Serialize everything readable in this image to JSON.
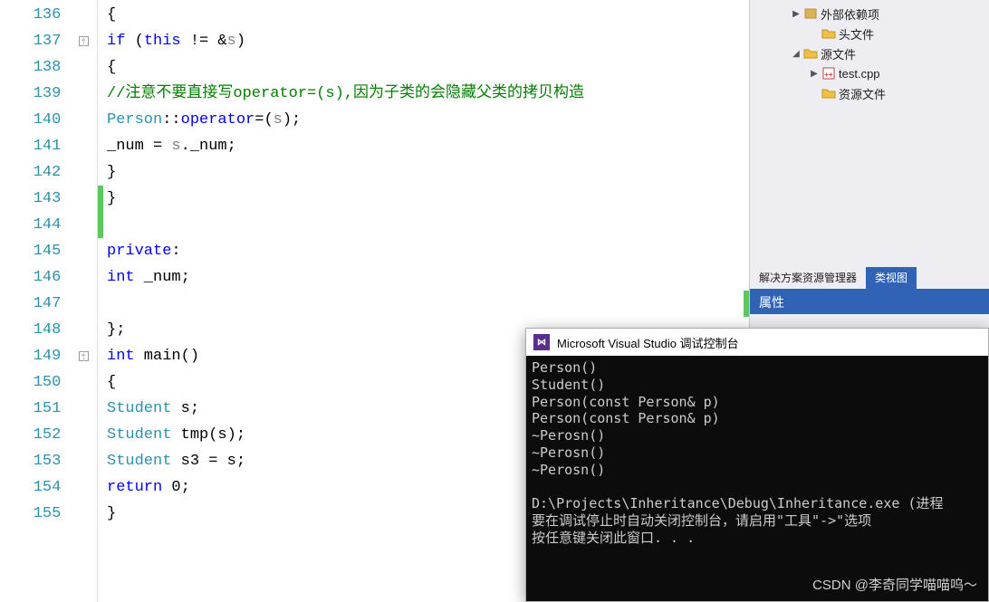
{
  "code": {
    "lines": [
      {
        "num": 136,
        "indent": 3,
        "tokens": [
          {
            "t": "{",
            "c": "punct"
          }
        ]
      },
      {
        "num": 137,
        "indent": 4,
        "fold": "-",
        "tokens": [
          {
            "t": "if",
            "c": "kw"
          },
          {
            "t": " (",
            "c": "punct"
          },
          {
            "t": "this",
            "c": "kw"
          },
          {
            "t": " != &",
            "c": "punct"
          },
          {
            "t": "s",
            "c": "gray"
          },
          {
            "t": ")",
            "c": "punct"
          }
        ]
      },
      {
        "num": 138,
        "indent": 4,
        "tokens": [
          {
            "t": "{",
            "c": "punct"
          }
        ]
      },
      {
        "num": 139,
        "indent": 5,
        "tokens": [
          {
            "t": "//注意不要直接写operator=(s),因为子类的会隐藏父类的拷贝构造",
            "c": "comment"
          }
        ]
      },
      {
        "num": 140,
        "indent": 5,
        "tokens": [
          {
            "t": "Person",
            "c": "type"
          },
          {
            "t": "::",
            "c": "punct"
          },
          {
            "t": "operator",
            "c": "kw"
          },
          {
            "t": "=(",
            "c": "punct"
          },
          {
            "t": "s",
            "c": "gray"
          },
          {
            "t": ");",
            "c": "punct"
          }
        ]
      },
      {
        "num": 141,
        "indent": 5,
        "tokens": [
          {
            "t": "_num = ",
            "c": "ident"
          },
          {
            "t": "s",
            "c": "gray"
          },
          {
            "t": "._num;",
            "c": "ident"
          }
        ]
      },
      {
        "num": 142,
        "indent": 4,
        "tokens": [
          {
            "t": "}",
            "c": "punct"
          }
        ]
      },
      {
        "num": 143,
        "indent": 3,
        "change": true,
        "tokens": [
          {
            "t": "}",
            "c": "punct"
          }
        ]
      },
      {
        "num": 144,
        "indent": 2,
        "change": true,
        "tokens": []
      },
      {
        "num": 145,
        "indent": 2,
        "tokens": [
          {
            "t": "private",
            "c": "kw"
          },
          {
            "t": ":",
            "c": "punct"
          }
        ]
      },
      {
        "num": 146,
        "indent": 3,
        "tokens": [
          {
            "t": "int",
            "c": "kw"
          },
          {
            "t": " _num;",
            "c": "ident"
          }
        ]
      },
      {
        "num": 147,
        "indent": 0,
        "change_right": true,
        "tokens": []
      },
      {
        "num": 148,
        "indent": 2,
        "tokens": [
          {
            "t": "};",
            "c": "punct"
          }
        ]
      },
      {
        "num": 149,
        "indent": 2,
        "fold": "-",
        "tokens": [
          {
            "t": "int",
            "c": "kw"
          },
          {
            "t": " main()",
            "c": "ident"
          }
        ]
      },
      {
        "num": 150,
        "indent": 2,
        "tokens": [
          {
            "t": "{",
            "c": "punct"
          }
        ]
      },
      {
        "num": 151,
        "indent": 3,
        "tokens": [
          {
            "t": "Student",
            "c": "type"
          },
          {
            "t": " s;",
            "c": "ident"
          }
        ]
      },
      {
        "num": 152,
        "indent": 3,
        "tokens": [
          {
            "t": "Student",
            "c": "type"
          },
          {
            "t": " tmp(s);",
            "c": "ident"
          }
        ]
      },
      {
        "num": 153,
        "indent": 3,
        "tokens": [
          {
            "t": "Student",
            "c": "type"
          },
          {
            "t": " s3 = s;",
            "c": "ident"
          }
        ]
      },
      {
        "num": 154,
        "indent": 3,
        "tokens": [
          {
            "t": "return",
            "c": "kw"
          },
          {
            "t": " 0;",
            "c": "ident"
          }
        ]
      },
      {
        "num": 155,
        "indent": 2,
        "tokens": [
          {
            "t": "}",
            "c": "punct"
          }
        ]
      }
    ]
  },
  "solution": {
    "items": [
      {
        "level": 1,
        "arrow": "▶",
        "icon": "dep",
        "label": "外部依赖项"
      },
      {
        "level": 2,
        "arrow": "",
        "icon": "folder",
        "label": "头文件"
      },
      {
        "level": 1,
        "arrow": "◢",
        "icon": "folder",
        "label": "源文件"
      },
      {
        "level": 2,
        "arrow": "▶",
        "icon": "cpp",
        "label": "test.cpp"
      },
      {
        "level": 2,
        "arrow": "",
        "icon": "folder",
        "label": "资源文件"
      }
    ]
  },
  "tabs": {
    "tab1": "解决方案资源管理器",
    "tab2": "类视图"
  },
  "props": {
    "title": "属性"
  },
  "console": {
    "title": "Microsoft Visual Studio 调试控制台",
    "lines": [
      "Person()",
      "Student()",
      "Person(const Person& p)",
      "Person(const Person& p)",
      "~Perosn()",
      "~Perosn()",
      "~Perosn()",
      "",
      "D:\\Projects\\Inheritance\\Debug\\Inheritance.exe (进程",
      "要在调试停止时自动关闭控制台，请启用\"工具\"->\"选项",
      "按任意键关闭此窗口. . ."
    ]
  },
  "watermark": "CSDN @李奇同学喵喵呜～"
}
